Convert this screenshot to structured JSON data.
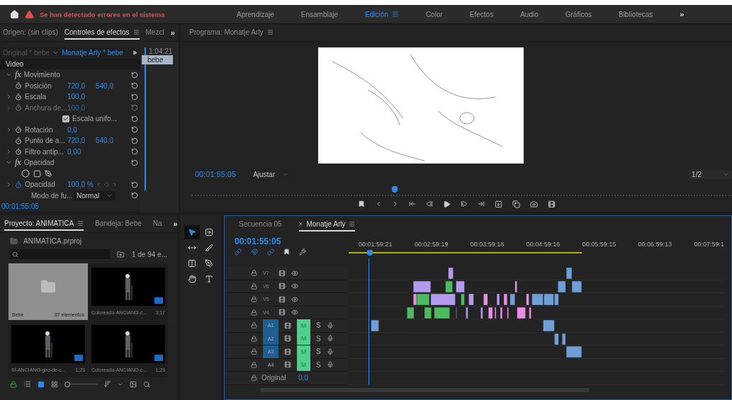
{
  "header": {
    "error": "Se han detectado errores en el sistema",
    "more": "»",
    "workspaces": [
      {
        "label": "Aprendizaje",
        "selected": false
      },
      {
        "label": "Ensamblaje",
        "selected": false
      },
      {
        "label": "Edición",
        "selected": true
      },
      {
        "label": "Color",
        "selected": false
      },
      {
        "label": "Efectos",
        "selected": false
      },
      {
        "label": "Audio",
        "selected": false
      },
      {
        "label": "Gráficos",
        "selected": false
      },
      {
        "label": "Bibliotecas",
        "selected": false
      }
    ]
  },
  "source_panel": {
    "more": "»",
    "tabs": [
      {
        "label": "Origen: (sin clips)",
        "selected": false
      },
      {
        "label": "Controles de efectos",
        "selected": true
      },
      {
        "label": "Mezcl",
        "selected": false
      }
    ]
  },
  "effect_controls": {
    "master": "Original * bebe",
    "clip": "Monatje Arly * bebe",
    "timecode": "1:04:21",
    "clip_label": "bebe",
    "section": "Video",
    "time": "00:01:55:05",
    "rows": [
      {
        "kind": "group",
        "badge": "fx",
        "label": "Movimiento",
        "expanded": true
      },
      {
        "kind": "prop",
        "label": "Posición",
        "values": [
          "720,0",
          "540,0"
        ],
        "expandable": false,
        "animated": false,
        "disabled": false
      },
      {
        "kind": "prop",
        "label": "Escala",
        "values": [
          "100,0"
        ],
        "expandable": true,
        "animated": false,
        "disabled": false
      },
      {
        "kind": "prop",
        "label": "Anchura de...",
        "values": [
          "100,0"
        ],
        "expandable": true,
        "animated": false,
        "disabled": true
      },
      {
        "kind": "checkbox",
        "label": "Escala unifo...",
        "checked": true
      },
      {
        "kind": "prop",
        "label": "Rotación",
        "values": [
          "0,0"
        ],
        "expandable": true,
        "animated": false,
        "disabled": false
      },
      {
        "kind": "prop",
        "label": "Punto de a...",
        "values": [
          "720,0",
          "540,0"
        ],
        "expandable": false,
        "animated": false,
        "disabled": false
      },
      {
        "kind": "prop",
        "label": "Filtro antip...",
        "values": [
          "0,00"
        ],
        "expandable": true,
        "animated": false,
        "disabled": false
      },
      {
        "kind": "group",
        "badge": "fx",
        "label": "Opacidad",
        "expanded": true
      },
      {
        "kind": "shapes"
      },
      {
        "kind": "prop",
        "label": "Opacidad",
        "values": [
          "100,0 %"
        ],
        "expandable": true,
        "animated": true,
        "disabled": false
      },
      {
        "kind": "dropdown",
        "label": "Modo de fu...",
        "value": "Normal"
      }
    ]
  },
  "program": {
    "tab": "Programa: Monatje Arly",
    "timecode": "00:01:55:05",
    "fit": "Ajustar",
    "resolution": "1/2"
  },
  "project": {
    "more": "»",
    "thumbnail_size": {
      "level": 0.05
    },
    "file": "ANIMATICA.prproj",
    "count": "1 de 94 e...",
    "tabs": [
      {
        "label": "Proyecto: ANIMATICA",
        "selected": true
      },
      {
        "label": "Bandeja: Bebe",
        "selected": false
      },
      {
        "label": "Na",
        "selected": false
      }
    ],
    "items": [
      {
        "kind": "folder",
        "name": "Bebe",
        "info": "87 elementos",
        "selected": true
      },
      {
        "kind": "clip",
        "name": "Coloreado-ANCIANO-c...",
        "info": "3;17",
        "selected": false
      },
      {
        "kind": "clip",
        "name": "SÍ-ANCIANO-giro-de-c...",
        "info": "1;23",
        "selected": false
      },
      {
        "kind": "clip",
        "name": "Coloreado-ANCIANO-c...",
        "info": "1;23",
        "selected": false
      }
    ]
  },
  "tools": [
    {
      "kind": "select",
      "selected": true
    },
    {
      "kind": "track-select",
      "selected": false
    },
    {
      "kind": "ripple",
      "selected": false
    },
    {
      "kind": "razor",
      "selected": false
    },
    {
      "kind": "slip",
      "selected": false
    },
    {
      "kind": "pen",
      "selected": false
    },
    {
      "kind": "hand",
      "selected": false
    },
    {
      "kind": "type",
      "selected": false
    }
  ],
  "timeline": {
    "timecode": "00:01:55:05",
    "tabs": [
      {
        "label": "Secuencia 05",
        "selected": false
      },
      {
        "label": "Monatje Arly",
        "selected": true,
        "close": "×"
      }
    ],
    "ruler": [
      "00:01:59:21",
      "00:02:59:19",
      "00:03:59:18",
      "00:04:59:16",
      "00:05:59:15",
      "00:06:59:13",
      "00:07:59:1"
    ],
    "video_tracks": [
      {
        "name": "V7"
      },
      {
        "name": "V6"
      },
      {
        "name": "V5"
      },
      {
        "name": "V4"
      }
    ],
    "audio_tracks": [
      {
        "name": "A1",
        "targeted": true,
        "muted": true,
        "mute_label": "M",
        "solo_label": "S"
      },
      {
        "name": "A2",
        "targeted": true,
        "muted": true,
        "mute_label": "M",
        "solo_label": "S"
      },
      {
        "name": "A3",
        "targeted": true,
        "muted": true,
        "mute_label": "M",
        "solo_label": "S"
      },
      {
        "name": "A4",
        "targeted": false,
        "muted": true,
        "mute_label": "M",
        "solo_label": "S"
      }
    ],
    "master": {
      "label": "Original",
      "value": "0,0"
    }
  }
}
